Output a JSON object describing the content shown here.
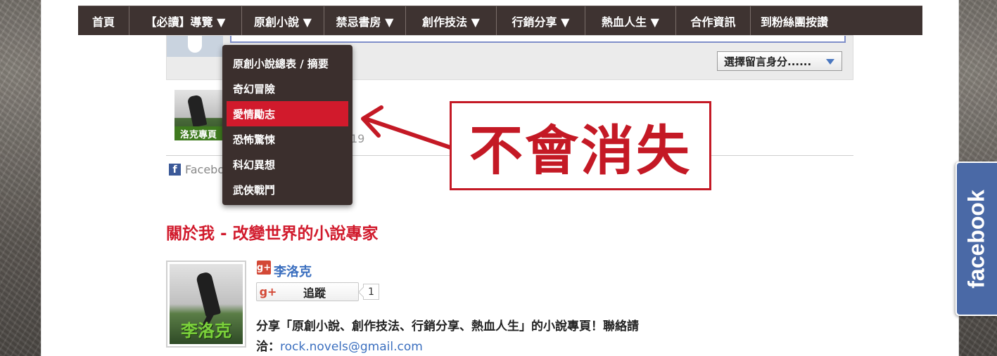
{
  "nav": {
    "items": [
      {
        "label": "首頁"
      },
      {
        "label": "【必讀】導覽 ▼"
      },
      {
        "label": "原創小說 ▼"
      },
      {
        "label": "禁忌書房 ▼"
      },
      {
        "label": "創作技法 ▼"
      },
      {
        "label": "行銷分享 ▼"
      },
      {
        "label": "熱血人生 ▼"
      },
      {
        "label": "合作資訊"
      },
      {
        "label": "到粉絲團按讚"
      }
    ]
  },
  "dropdown": {
    "items": [
      {
        "label": "原創小說總表 / 摘要"
      },
      {
        "label": "奇幻冒險"
      },
      {
        "label": "愛情勵志",
        "active": true
      },
      {
        "label": "恐怖驚悚"
      },
      {
        "label": "科幻異想"
      },
      {
        "label": "武俠戰鬥"
      }
    ]
  },
  "comments": {
    "identity_select": "選擇留言身分......",
    "thumb_caption": "洛克專頁",
    "date_fragment": "19",
    "facebook_label": "Facebo"
  },
  "annotation": {
    "text": "不會消失",
    "color": "#c41925"
  },
  "about": {
    "title": "關於我 - 改變世界的小說專家",
    "photo_caption": "李洛克",
    "author_name": "李洛克",
    "follow_label": "追蹤",
    "follow_count": "1",
    "gplus_icon": "g+",
    "description_line1": "分享「原創小說、創作技法、行銷分享、熱血人生」的小說專頁！聯絡請",
    "description_line2_prefix": "洽：",
    "email": "rock.novels@gmail.com"
  },
  "facebook_tab": {
    "label": "facebook"
  },
  "colors": {
    "nav_bg": "#3e3331",
    "active_item": "#d11a2c",
    "link_blue": "#3b6fbf",
    "facebook_blue": "#4a69a6"
  }
}
